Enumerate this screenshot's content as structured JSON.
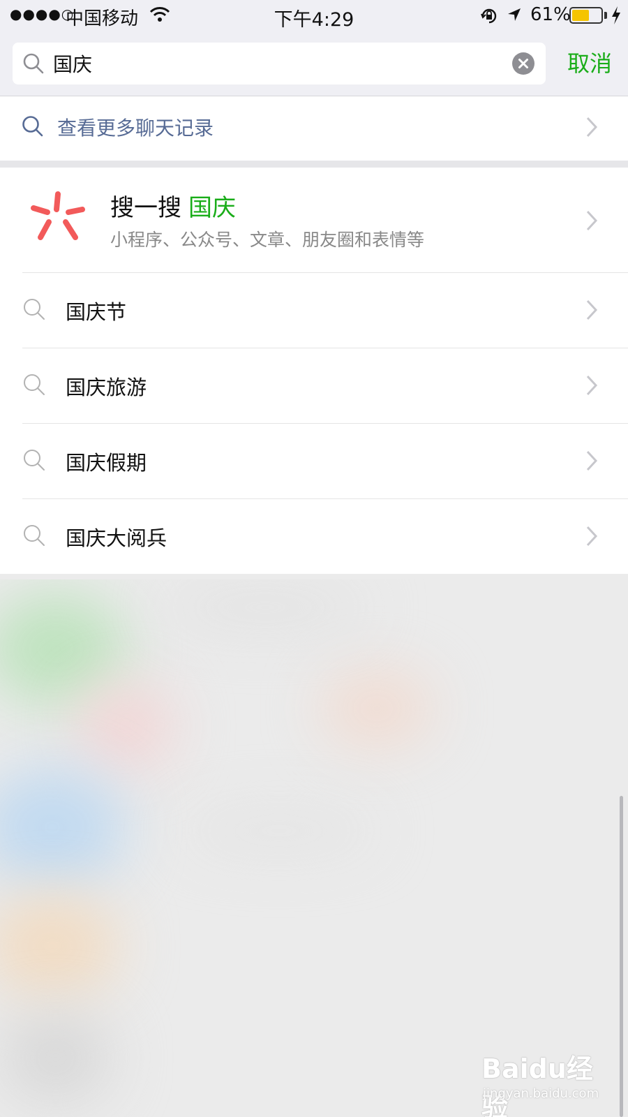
{
  "status_bar": {
    "signal": "●●●●○",
    "carrier": "中国移动",
    "time": "下午4:29",
    "battery_percent": "61%",
    "battery_level": 0.61,
    "battery_color": "#f5c400"
  },
  "search": {
    "query": "国庆",
    "cancel_label": "取消",
    "accent_color": "#1aad19"
  },
  "more_chats": {
    "label": "查看更多聊天记录",
    "link_color": "#576b95"
  },
  "souyisou": {
    "title": "搜一搜",
    "keyword": "国庆",
    "subtitle": "小程序、公众号、文章、朋友圈和表情等",
    "logo_color": "#f25a5a"
  },
  "suggestions": [
    {
      "label": "国庆节"
    },
    {
      "label": "国庆旅游"
    },
    {
      "label": "国庆假期"
    },
    {
      "label": "国庆大阅兵"
    }
  ],
  "watermark": {
    "brand": "Baidu经验",
    "url": "jingyan.baidu.com"
  },
  "icons": [
    "wifi-icon",
    "rotation-lock-icon",
    "location-arrow-icon",
    "battery-icon",
    "charging-icon",
    "search-icon",
    "clear-icon",
    "chevron-right-icon",
    "souyisou-logo-icon"
  ]
}
